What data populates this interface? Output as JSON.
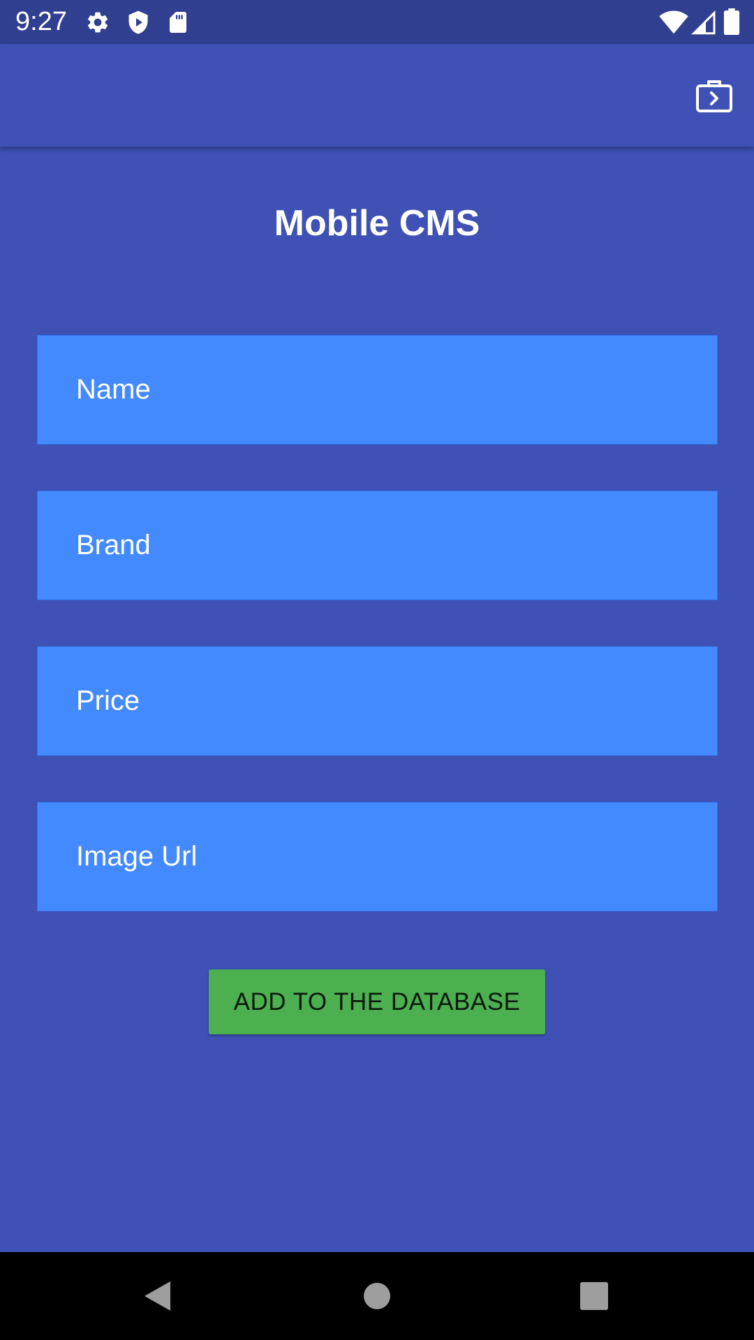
{
  "status_bar": {
    "time": "9:27",
    "left_icons": [
      "gear-icon",
      "shield-play-icon",
      "sd-card-icon"
    ],
    "right_icons": [
      "wifi-icon",
      "cell-signal-icon",
      "battery-icon"
    ]
  },
  "app_bar": {
    "action_icon": "briefcase-arrow-icon"
  },
  "page": {
    "title": "Mobile CMS"
  },
  "form": {
    "fields": [
      {
        "placeholder": "Name",
        "value": ""
      },
      {
        "placeholder": "Brand",
        "value": ""
      },
      {
        "placeholder": "Price",
        "value": ""
      },
      {
        "placeholder": "Image Url",
        "value": ""
      }
    ],
    "submit_label": "ADD TO THE DATABASE"
  },
  "colors": {
    "status_bar": "#303f8f",
    "primary": "#3f51b5",
    "field_background": "#448aff",
    "button_background": "#4caf50",
    "nav_bar": "#000000"
  },
  "nav_bar": {
    "buttons": [
      "back-icon",
      "home-icon",
      "recents-icon"
    ]
  }
}
